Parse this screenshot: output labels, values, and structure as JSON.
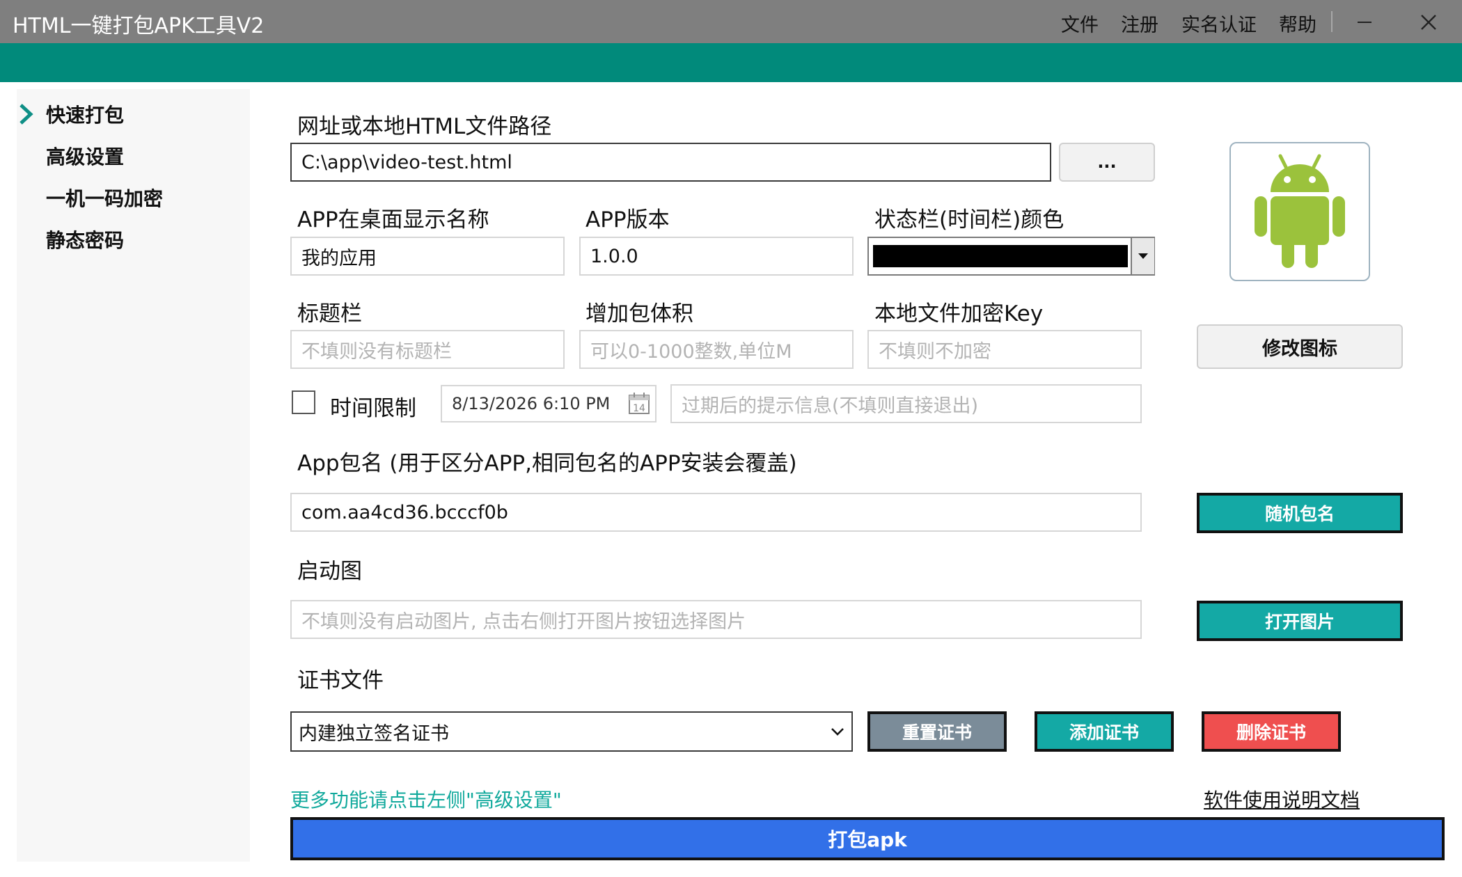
{
  "window": {
    "title": "HTML一键打包APK工具V2",
    "menu": [
      "文件",
      "注册",
      "实名认证",
      "帮助"
    ]
  },
  "sidebar": {
    "items": [
      {
        "label": "快速打包",
        "active": true
      },
      {
        "label": "高级设置"
      },
      {
        "label": "一机一码加密"
      },
      {
        "label": "静态密码"
      }
    ]
  },
  "form": {
    "path_label": "网址或本地HTML文件路径",
    "path_value": "C:\\app\\video-test.html",
    "browse_label": "...",
    "app_name_label": "APP在桌面显示名称",
    "app_name_value": "我的应用",
    "version_label": "APP版本",
    "version_value": "1.0.0",
    "statusbar_label": "状态栏(时间栏)颜色",
    "statusbar_color": "#000000",
    "titlebar_label": "标题栏",
    "titlebar_placeholder": "不填则没有标题栏",
    "size_label": "增加包体积",
    "size_placeholder": "可以0-1000整数,单位M",
    "key_label": "本地文件加密Key",
    "key_placeholder": "不填则不加密",
    "time_limit_label": "时间限制",
    "time_limit_checked": false,
    "date_value": "8/13/2026 6:10 PM",
    "calendar_day": "14",
    "expire_placeholder": "过期后的提示信息(不填则直接退出)",
    "package_label": "App包名 (用于区分APP,相同包名的APP安装会覆盖)",
    "package_value": "com.aa4cd36.bcccf0b",
    "splash_label": "启动图",
    "splash_placeholder": "不填则没有启动图片, 点击右侧打开图片按钮选择图片",
    "cert_label": "证书文件",
    "cert_value": "内建独立签名证书",
    "more_link": "更多功能请点击左侧\"高级设置\"",
    "doc_link": "软件使用说明文档"
  },
  "buttons": {
    "change_icon": "修改图标",
    "random_package": "随机包名",
    "open_image": "打开图片",
    "reset_cert": "重置证书",
    "add_cert": "添加证书",
    "delete_cert": "删除证书",
    "build": "打包apk"
  },
  "colors": {
    "teal": "#14a9a5",
    "reset_gray": "#7b8c99",
    "delete_red": "#ef4f4f",
    "build_blue": "#3270e8",
    "link_teal": "#11a99c",
    "android_green": "#9bc23c"
  },
  "icons": {
    "sidebar_active": "chevron-right-icon",
    "app_icon": "android-robot-icon",
    "dropdown": "chevron-down-icon",
    "calendar": "calendar-icon"
  }
}
